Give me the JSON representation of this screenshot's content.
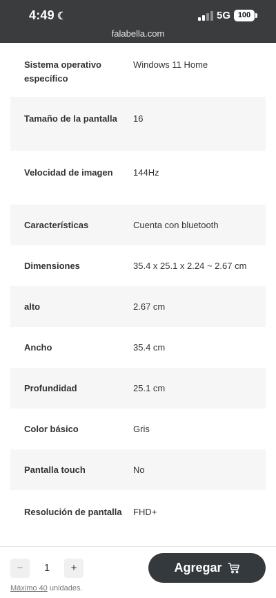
{
  "status_bar": {
    "time": "4:49",
    "network": "5G",
    "battery": "100"
  },
  "browser": {
    "url": "falabella.com"
  },
  "specs": [
    {
      "label": "Sistema operativo específico",
      "value": "Windows 11 Home"
    },
    {
      "label": "Tamaño de la pantalla",
      "value": "16"
    },
    {
      "label": "Velocidad de imagen",
      "value": "144Hz"
    },
    {
      "label": "Características",
      "value": "Cuenta con bluetooth"
    },
    {
      "label": "Dimensiones",
      "value": "35.4 x 25.1 x 2.24 ~ 2.67 cm"
    },
    {
      "label": "alto",
      "value": "2.67 cm"
    },
    {
      "label": "Ancho",
      "value": "35.4 cm"
    },
    {
      "label": "Profundidad",
      "value": "25.1 cm"
    },
    {
      "label": "Color básico",
      "value": "Gris"
    },
    {
      "label": "Pantalla touch",
      "value": "No"
    },
    {
      "label": "Resolución de pantalla",
      "value": "FHD+"
    }
  ],
  "cart": {
    "decrement_label": "−",
    "increment_label": "+",
    "quantity": "1",
    "max_prefix": "Máximo 40",
    "max_suffix": " unidades.",
    "add_label": "Agregar"
  },
  "colors": {
    "topbar": "#3a3c3e",
    "row_shade": "#f6f6f6",
    "add_button": "#34393d"
  }
}
